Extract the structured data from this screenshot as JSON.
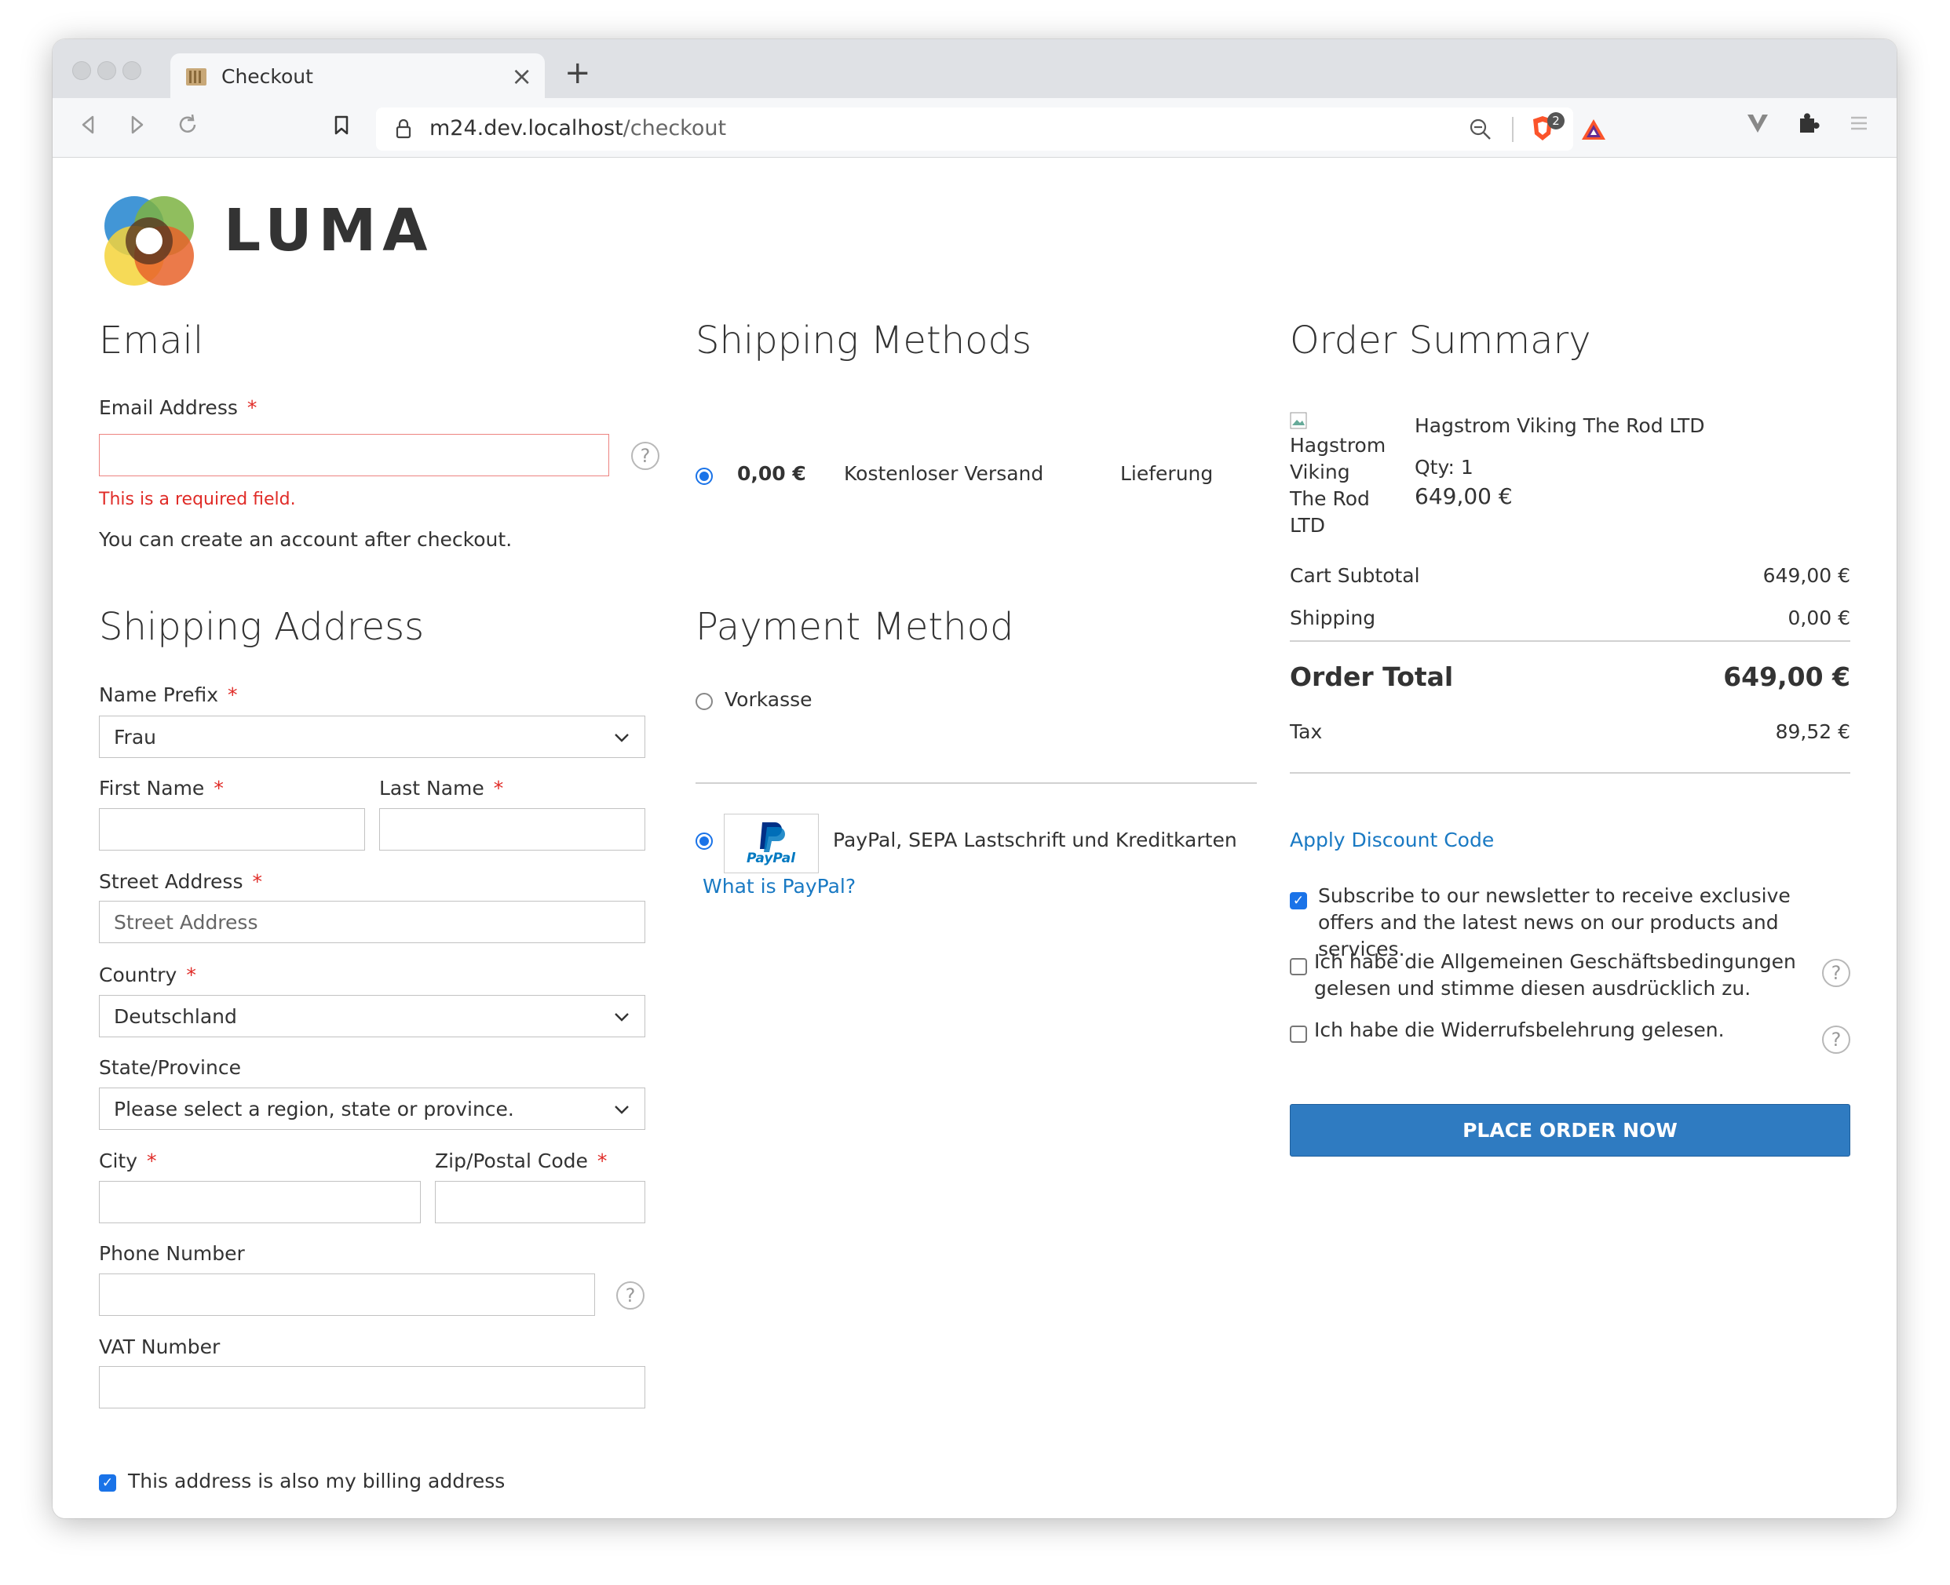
{
  "browser": {
    "tab_title": "Checkout",
    "tab_close": "×",
    "new_tab": "+",
    "url_host": "m24.dev.localhost",
    "url_path": "/checkout",
    "shield_badge": "2"
  },
  "brand": {
    "logo_text": "LUMA"
  },
  "email": {
    "title": "Email",
    "label": "Email Address",
    "required_mark": "*",
    "value": "",
    "error": "This is a required field.",
    "note": "You can create an account after checkout."
  },
  "shipping_address": {
    "title": "Shipping Address",
    "name_prefix_label": "Name Prefix",
    "name_prefix_value": "Frau",
    "first_name_label": "First Name",
    "last_name_label": "Last Name",
    "street_label": "Street Address",
    "street_placeholder": "Street Address",
    "country_label": "Country",
    "country_value": "Deutschland",
    "state_label": "State/Province",
    "state_value": "Please select a region, state or province.",
    "city_label": "City",
    "zip_label": "Zip/Postal Code",
    "phone_label": "Phone Number",
    "vat_label": "VAT Number",
    "billing_same_label": "This address is also my billing address",
    "billing_same_checked": true
  },
  "shipping_methods": {
    "title": "Shipping Methods",
    "options": [
      {
        "price": "0,00 €",
        "method": "Kostenloser Versand",
        "carrier": "Lieferung",
        "selected": true
      }
    ]
  },
  "payment": {
    "title": "Payment Method",
    "option_prepay": "Vorkasse",
    "option_paypal": "PayPal, SEPA Lastschrift und Kreditkarten",
    "paypal_logo_text": "PayPal",
    "what_is_paypal": "What is PayPal?"
  },
  "order_summary": {
    "title": "Order Summary",
    "item": {
      "image_alt": "Hagstrom Viking The Rod LTD",
      "name": "Hagstrom Viking The Rod LTD",
      "qty": "Qty: 1",
      "price": "649,00 €"
    },
    "cart_subtotal_label": "Cart Subtotal",
    "cart_subtotal_value": "649,00 €",
    "shipping_label": "Shipping",
    "shipping_value": "0,00 €",
    "order_total_label": "Order Total",
    "order_total_value": "649,00 €",
    "tax_label": "Tax",
    "tax_value": "89,52 €",
    "discount_link": "Apply Discount Code",
    "newsletter_label": "Subscribe to our newsletter to receive exclusive offers and the latest news on our products and services.",
    "agb_label": "Ich habe die Allgemeinen Geschäftsbedingungen gelesen und stimme diesen ausdrücklich zu.",
    "withdrawal_label": "Ich habe die Widerrufsbelehrung gelesen.",
    "place_order": "PLACE ORDER NOW"
  },
  "colors": {
    "accent": "#1979c3",
    "button": "#2f7bc1",
    "error": "#e02b27",
    "radio_checked": "#1a73e8"
  }
}
